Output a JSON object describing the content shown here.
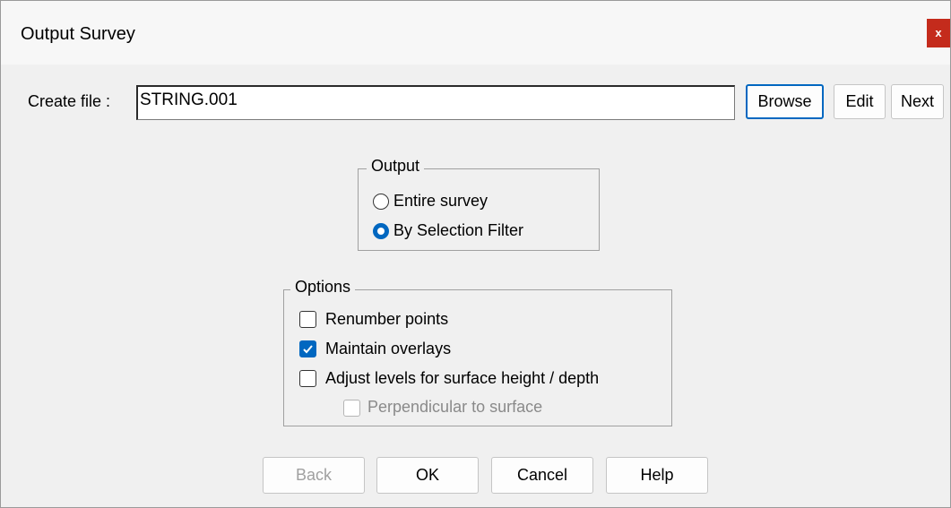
{
  "window": {
    "title": "Output Survey",
    "close_label": "x"
  },
  "file": {
    "label": "Create file :",
    "value": "STRING.001"
  },
  "file_buttons": {
    "browse": "Browse",
    "edit": "Edit",
    "next": "Next"
  },
  "output": {
    "legend": "Output",
    "options": [
      "Entire survey",
      "By Selection Filter"
    ],
    "selected": "By Selection Filter"
  },
  "options": {
    "legend": "Options",
    "renumber": {
      "label": "Renumber points",
      "checked": false
    },
    "maintain": {
      "label": "Maintain overlays",
      "checked": true
    },
    "adjust": {
      "label": "Adjust levels for surface height / depth",
      "checked": false
    },
    "perpendicular": {
      "label": "Perpendicular to surface",
      "checked": false,
      "enabled": false
    }
  },
  "buttons": {
    "back": "Back",
    "ok": "OK",
    "cancel": "Cancel",
    "help": "Help"
  },
  "colors": {
    "accent": "#0067c0",
    "close": "#c42b1c"
  }
}
